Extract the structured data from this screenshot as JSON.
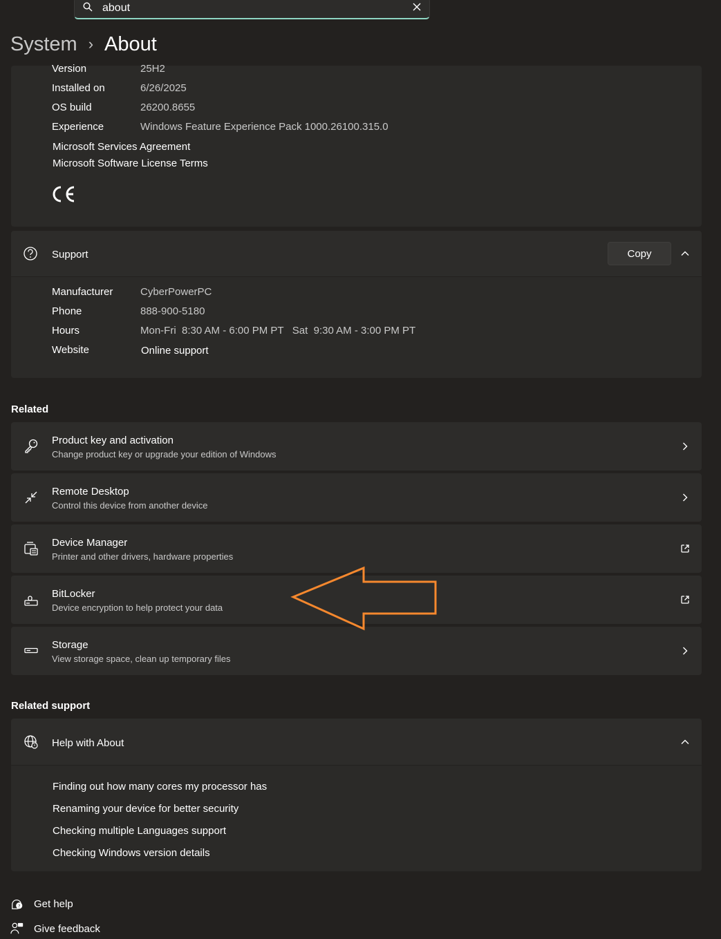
{
  "search": {
    "value": "about"
  },
  "breadcrumb": {
    "parent": "System",
    "separator": "›",
    "current": "About"
  },
  "windows_spec": {
    "rows": [
      {
        "label": "Version",
        "value": "25H2"
      },
      {
        "label": "Installed on",
        "value": "6/26/2025"
      },
      {
        "label": "OS build",
        "value": "26200.8655"
      },
      {
        "label": "Experience",
        "value": "Windows Feature Experience Pack 1000.26100.315.0"
      }
    ],
    "links": [
      "Microsoft Services Agreement",
      "Microsoft Software License Terms"
    ],
    "mark": "CE"
  },
  "support": {
    "title": "Support",
    "copy_label": "Copy",
    "rows": [
      {
        "label": "Manufacturer",
        "value": "CyberPowerPC"
      },
      {
        "label": "Phone",
        "value": "888-900-5180"
      },
      {
        "label": "Hours",
        "value": "Mon-Fri  8:30 AM - 6:00 PM PT   Sat  9:30 AM - 3:00 PM PT"
      },
      {
        "label": "Website",
        "value": "Online support"
      }
    ]
  },
  "related": {
    "title": "Related",
    "items": [
      {
        "title": "Product key and activation",
        "subtitle": "Change product key or upgrade your edition of Windows",
        "icon": "key-icon",
        "action": "chevron-right-icon"
      },
      {
        "title": "Remote Desktop",
        "subtitle": "Control this device from another device",
        "icon": "remote-desktop-icon",
        "action": "chevron-right-icon"
      },
      {
        "title": "Device Manager",
        "subtitle": "Printer and other drivers, hardware properties",
        "icon": "device-manager-icon",
        "action": "external-link-icon"
      },
      {
        "title": "BitLocker",
        "subtitle": "Device encryption to help protect your data",
        "icon": "bitlocker-icon",
        "action": "external-link-icon"
      },
      {
        "title": "Storage",
        "subtitle": "View storage space, clean up temporary files",
        "icon": "storage-icon",
        "action": "chevron-right-icon"
      }
    ]
  },
  "related_support": {
    "title": "Related support",
    "help_title": "Help with About",
    "links": [
      "Finding out how many cores my processor has",
      "Renaming your device for better security",
      "Checking multiple Languages support",
      "Checking Windows version details"
    ]
  },
  "footer": {
    "get_help": "Get help",
    "give_feedback": "Give feedback"
  },
  "colors": {
    "background": "#23211f",
    "card": "#2b2a28",
    "accent": "#8fd6c4",
    "annotation_arrow": "#f5882e"
  }
}
